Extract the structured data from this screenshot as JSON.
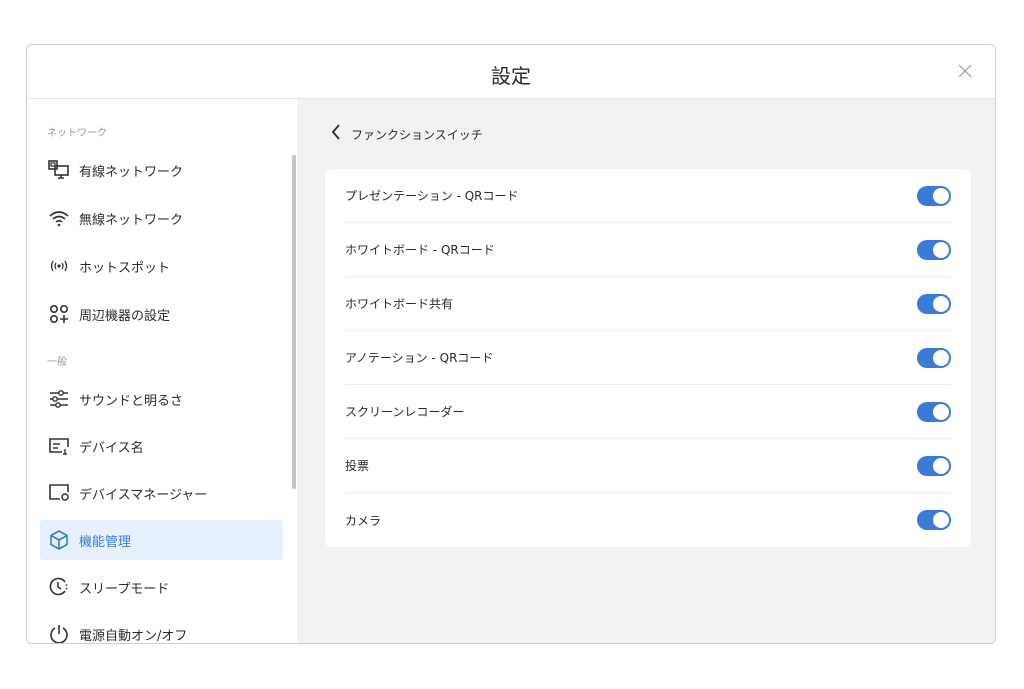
{
  "dialog": {
    "title": "設定"
  },
  "sidebar": {
    "sections": [
      {
        "label": "ネットワーク",
        "items": [
          {
            "label": "有線ネットワーク",
            "icon": "wired-network-icon"
          },
          {
            "label": "無線ネットワーク",
            "icon": "wifi-icon"
          },
          {
            "label": "ホットスポット",
            "icon": "hotspot-icon"
          },
          {
            "label": "周辺機器の設定",
            "icon": "peripherals-icon"
          }
        ]
      },
      {
        "label": "一般",
        "items": [
          {
            "label": "サウンドと明るさ",
            "icon": "sliders-icon"
          },
          {
            "label": "デバイス名",
            "icon": "device-name-icon"
          },
          {
            "label": "デバイスマネージャー",
            "icon": "device-manager-icon"
          },
          {
            "label": "機能管理",
            "icon": "cube-icon",
            "active": true
          },
          {
            "label": "スリープモード",
            "icon": "sleep-clock-icon"
          },
          {
            "label": "電源自動オン/オフ",
            "icon": "power-icon"
          }
        ]
      }
    ]
  },
  "content": {
    "back_label": "ファンクションスイッチ",
    "toggles": [
      {
        "label": "プレゼンテーション - QRコード",
        "on": true
      },
      {
        "label": "ホワイトボード - QRコード",
        "on": true
      },
      {
        "label": "ホワイトボード共有",
        "on": true
      },
      {
        "label": "アノテーション - QRコード",
        "on": true
      },
      {
        "label": "スクリーンレコーダー",
        "on": true
      },
      {
        "label": "投票",
        "on": true
      },
      {
        "label": "カメラ",
        "on": true
      }
    ]
  },
  "colors": {
    "accent": "#3a7bd5",
    "active_bg": "#e6f1fd",
    "content_bg": "#f2f2f2"
  }
}
